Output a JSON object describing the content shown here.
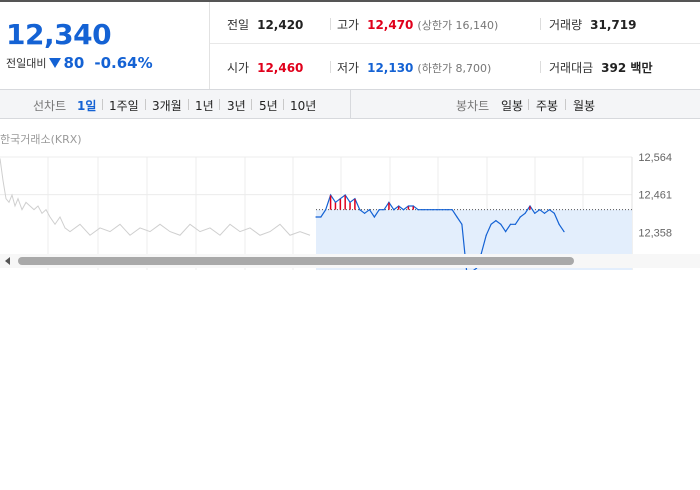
{
  "quote": {
    "price": "12,340",
    "change_label": "전일대비",
    "change_value": "80",
    "change_pct": "-0.64%",
    "prev_close": {
      "label": "전일",
      "value": "12,420"
    },
    "high": {
      "label": "고가",
      "value": "12,470",
      "sub": "(상한가 16,140)"
    },
    "volume": {
      "label": "거래량",
      "value": "31,719"
    },
    "open": {
      "label": "시가",
      "value": "12,460"
    },
    "low": {
      "label": "저가",
      "value": "12,130",
      "sub": "(하한가 8,700)"
    },
    "amount": {
      "label": "거래대금",
      "value": "392 백만"
    },
    "colors": {
      "up": "#e0001b",
      "down": "#1462d4"
    }
  },
  "tabs": {
    "line_title": "선차트",
    "line_tabs": [
      "1일",
      "1주일",
      "3개월",
      "1년",
      "3년",
      "5년",
      "10년"
    ],
    "line_active": "1일",
    "candle_title": "봉차트",
    "candle_tabs": [
      "일봉",
      "주봉",
      "월봉"
    ]
  },
  "chart": {
    "source": "한국거래소(KRX)",
    "y_ticks": [
      "12,564",
      "12,461",
      "12,358"
    ],
    "prev_close_value": 12420
  },
  "chart_data": {
    "type": "line",
    "title": "",
    "ylabel": "",
    "ylim": [
      12255,
      12564
    ],
    "series": [
      {
        "name": "",
        "values": [
          12400,
          12400,
          12420,
          12460,
          12440,
          12450,
          12460,
          12440,
          12450,
          12420,
          12410,
          12420,
          12400,
          12420,
          12420,
          12440,
          12420,
          12430,
          12420,
          12430,
          12430,
          12420,
          12420,
          12420,
          12420,
          12420,
          12420,
          12420,
          12420,
          12400,
          12380,
          12250,
          12250,
          12260,
          12300,
          12350,
          12380,
          12390,
          12380,
          12360,
          12380,
          12380,
          12400,
          12410,
          12430,
          12410,
          12420,
          12410,
          12420,
          12410,
          12380,
          12360
        ]
      }
    ]
  }
}
